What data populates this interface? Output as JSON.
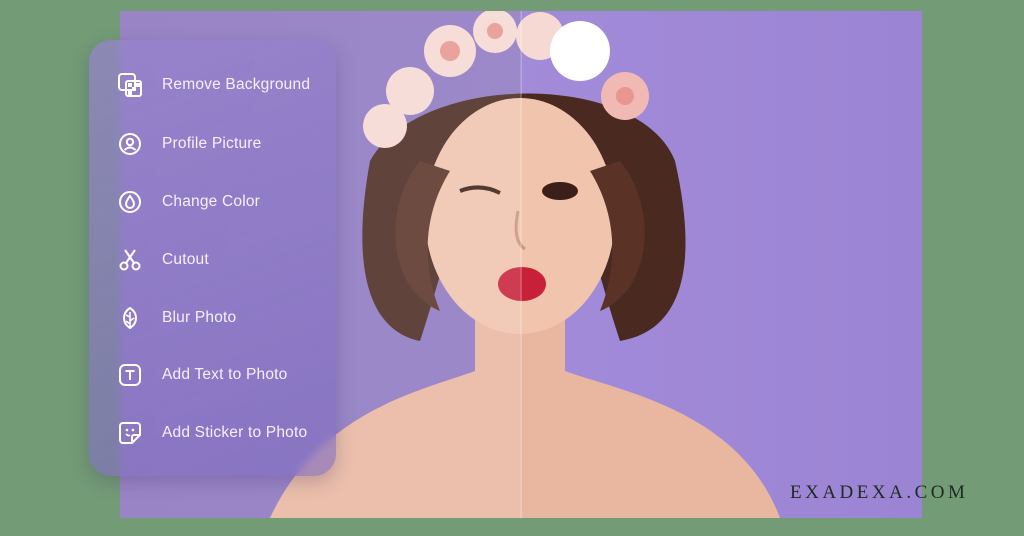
{
  "menu": {
    "items": [
      {
        "label": "Remove Background",
        "icon": "checkerboard-icon"
      },
      {
        "label": "Profile Picture",
        "icon": "profile-icon"
      },
      {
        "label": "Change Color",
        "icon": "color-drop-icon"
      },
      {
        "label": "Cutout",
        "icon": "scissors-icon"
      },
      {
        "label": "Blur Photo",
        "icon": "leaf-icon"
      },
      {
        "label": "Add Text to Photo",
        "icon": "text-icon"
      },
      {
        "label": "Add Sticker to Photo",
        "icon": "sticker-icon"
      }
    ]
  },
  "watermark": {
    "text": "EXADEXA.COM"
  },
  "colors": {
    "page_background": "#739b76",
    "photo_background_left": "#8b75be",
    "photo_background_right": "#a28bd9",
    "menu_text": "#f4f0ff"
  }
}
